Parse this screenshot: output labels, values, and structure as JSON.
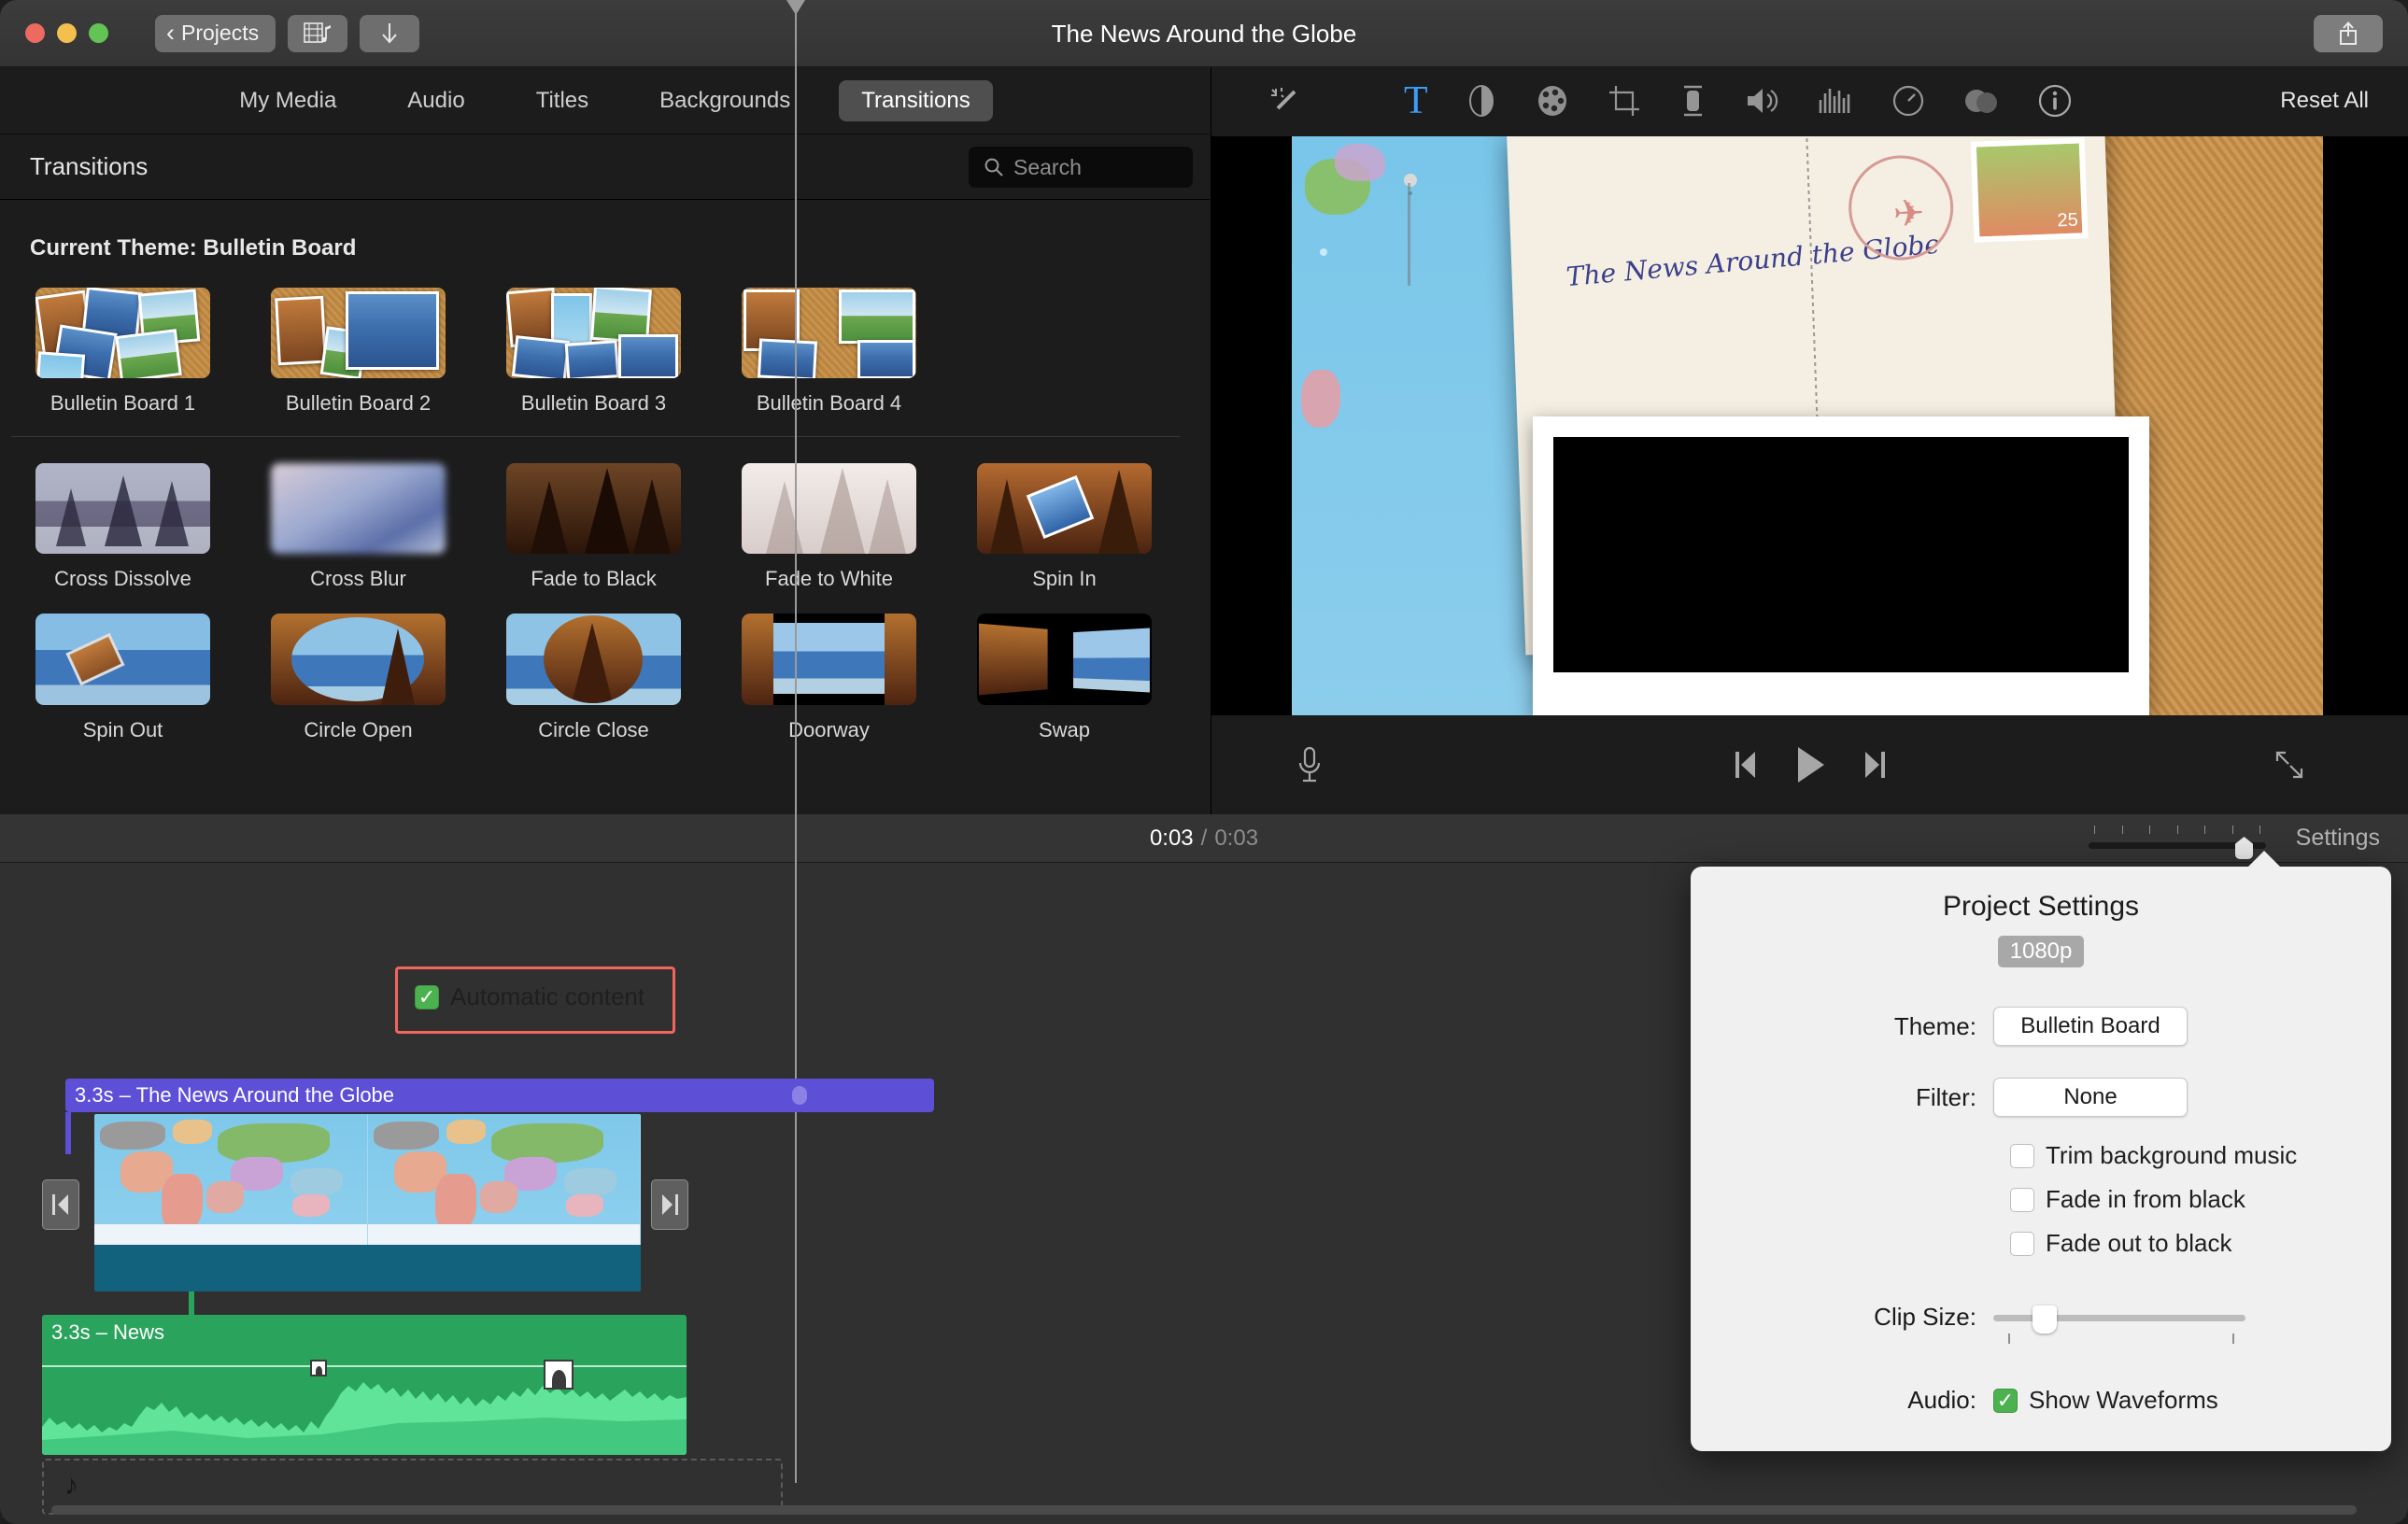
{
  "window": {
    "title": "The News Around the Globe",
    "back_button": "Projects",
    "media_import_icon": "film-music-icon",
    "download_icon": "download-arrow-icon",
    "share_icon": "share-icon",
    "traffic_lights": [
      "close",
      "minimize",
      "zoom"
    ]
  },
  "browser": {
    "tabs": [
      {
        "label": "My Media",
        "active": false
      },
      {
        "label": "Audio",
        "active": false
      },
      {
        "label": "Titles",
        "active": false
      },
      {
        "label": "Backgrounds",
        "active": false
      },
      {
        "label": "Transitions",
        "active": true
      }
    ],
    "panel_title": "Transitions",
    "search_placeholder": "Search",
    "search_value": "",
    "section_title": "Current Theme: Bulletin Board",
    "theme_transitions": [
      {
        "label": "Bulletin Board 1"
      },
      {
        "label": "Bulletin Board 2"
      },
      {
        "label": "Bulletin Board 3"
      },
      {
        "label": "Bulletin Board 4"
      }
    ],
    "standard_transitions_row1": [
      {
        "label": "Cross Dissolve"
      },
      {
        "label": "Cross Blur"
      },
      {
        "label": "Fade to Black"
      },
      {
        "label": "Fade to White"
      },
      {
        "label": "Spin In"
      }
    ],
    "standard_transitions_row2": [
      {
        "label": "Spin Out"
      },
      {
        "label": "Circle Open"
      },
      {
        "label": "Circle Close"
      },
      {
        "label": "Doorway"
      },
      {
        "label": "Swap"
      }
    ]
  },
  "viewer": {
    "toolbar_icons": [
      {
        "name": "magic-wand-icon",
        "active": false
      },
      {
        "name": "titles-text-icon",
        "active": true
      },
      {
        "name": "color-balance-icon",
        "active": false
      },
      {
        "name": "color-correction-icon",
        "active": false
      },
      {
        "name": "crop-icon",
        "active": false
      },
      {
        "name": "stabilization-icon",
        "active": false
      },
      {
        "name": "volume-icon",
        "active": false
      },
      {
        "name": "noise-reduction-icon",
        "active": false
      },
      {
        "name": "speed-icon",
        "active": false
      },
      {
        "name": "clip-filter-icon",
        "active": false
      },
      {
        "name": "info-icon",
        "active": false
      }
    ],
    "reset_all": "Reset All",
    "preview_caption": "The News Around the Globe",
    "stamp_value": "25",
    "playback": {
      "voiceover_icon": "microphone-icon",
      "previous_icon": "skip-previous-icon",
      "play_icon": "play-icon",
      "next_icon": "skip-next-icon",
      "fullscreen_icon": "fullscreen-icon"
    }
  },
  "timeline_toolbar": {
    "current_time": "0:03",
    "separator": "/",
    "total_time": "0:03",
    "settings_label": "Settings",
    "zoom_slider_name": "timeline-zoom-slider"
  },
  "timeline": {
    "title_clip": {
      "label": "3.3s – The News Around the Globe",
      "color": "#5d4fd6"
    },
    "video_clip": {
      "name": "world-map-video-clip"
    },
    "audio_clip": {
      "label": "3.3s – News",
      "color": "#2aa35c"
    },
    "trim_handle_left": "trim-handle-left",
    "trim_handle_right": "trim-handle-right",
    "music_dropzone_icon": "music-note-icon"
  },
  "project_settings": {
    "title": "Project Settings",
    "resolution_badge": "1080p",
    "theme_label": "Theme:",
    "theme_value": "Bulletin Board",
    "automatic_content_label": "Automatic content",
    "automatic_content_checked": true,
    "filter_label": "Filter:",
    "filter_value": "None",
    "checkboxes": [
      {
        "label": "Trim background music",
        "checked": false
      },
      {
        "label": "Fade in from black",
        "checked": false
      },
      {
        "label": "Fade out to black",
        "checked": false
      }
    ],
    "clip_size_label": "Clip Size:",
    "clip_size_value": 18,
    "audio_label": "Audio:",
    "show_waveforms_label": "Show Waveforms",
    "show_waveforms_checked": true,
    "highlight_color": "#f2655c",
    "accent_green": "#4cb14f"
  }
}
